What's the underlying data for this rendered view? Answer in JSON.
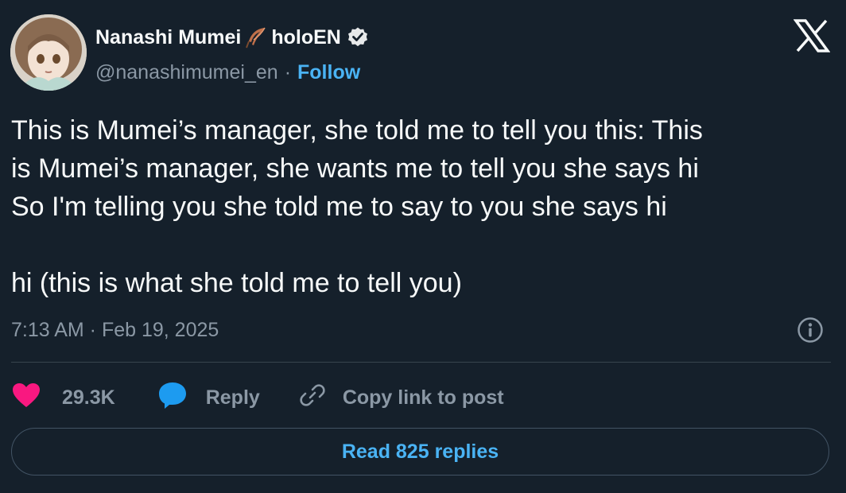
{
  "author": {
    "display_name": "Nanashi Mumei",
    "name_suffix": "holoEN",
    "handle": "@nanashimumei_en",
    "separator": "·",
    "follow_label": "Follow",
    "verified": true
  },
  "tweet": {
    "lines": [
      "This is Mumei’s manager, she told me to tell you this: This",
      "is Mumei’s manager, she wants me to tell you she says hi",
      "So I'm telling you she told me to say to you she says hi",
      "",
      "hi (this is what she told me to tell you)"
    ],
    "timestamp": "7:13 AM · Feb 19, 2025"
  },
  "actions": {
    "likes": "29.3K",
    "reply_label": "Reply",
    "copy_label": "Copy link to post"
  },
  "read_replies_label": "Read 825 replies",
  "icons": {
    "platform": "x-logo-icon",
    "name_emoji": "feather-icon",
    "verified": "verified-badge-icon",
    "info": "info-icon",
    "like": "heart-icon",
    "reply": "reply-bubble-icon",
    "copy": "link-icon"
  },
  "colors": {
    "background": "#15202b",
    "text": "#f7f9f9",
    "muted": "#8b98a5",
    "accent": "#4ab3f4",
    "heart": "#f91880",
    "reply_icon": "#1d9bf0"
  }
}
